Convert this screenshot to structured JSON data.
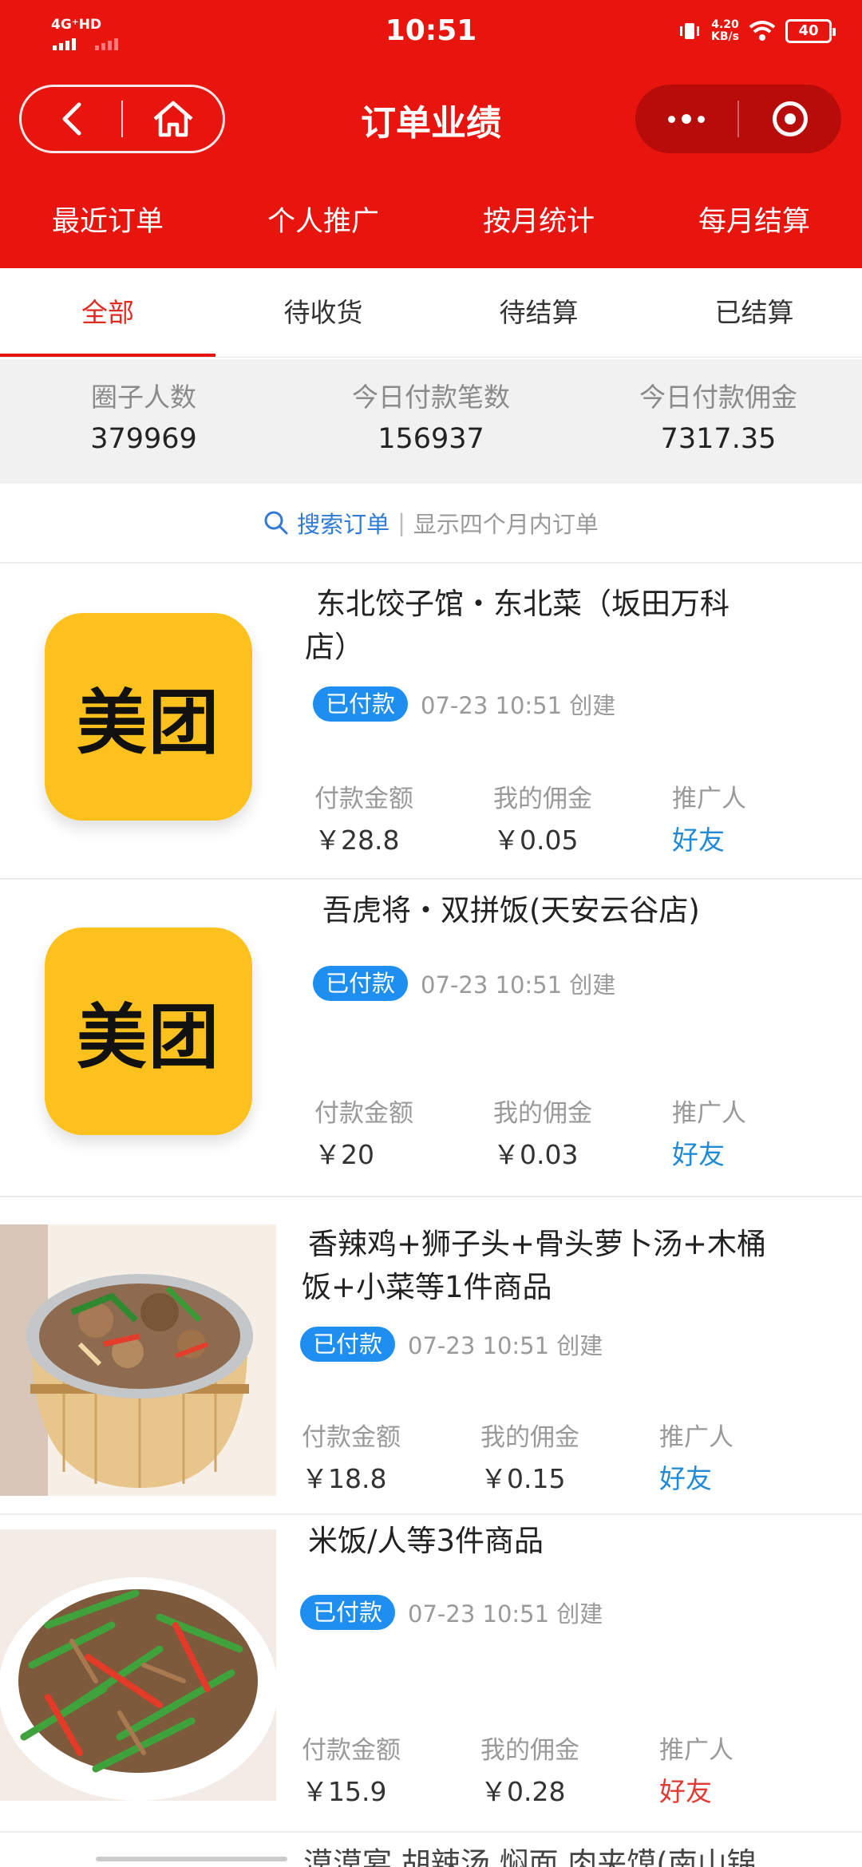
{
  "status_bar": {
    "network": "4G⁺HD",
    "time": "10:51",
    "speed_value": "4.20",
    "speed_unit": "KB/s",
    "battery": "40"
  },
  "header": {
    "title": "订单业绩",
    "back_icon": "back-arrow-icon",
    "home_icon": "home-icon",
    "more_icon": "more-dots-icon",
    "close_icon": "target-close-icon"
  },
  "top_tabs": [
    "最近订单",
    "个人推广",
    "按月统计",
    "每月结算"
  ],
  "sub_tabs": [
    "全部",
    "待收货",
    "待结算",
    "已结算"
  ],
  "active_sub_tab": 0,
  "stats": [
    {
      "label": "圈子人数",
      "value": "379969"
    },
    {
      "label": "今日付款笔数",
      "value": "156937"
    },
    {
      "label": "今日付款佣金",
      "value": "7317.35"
    }
  ],
  "search": {
    "link": "搜索订单",
    "separator": "|",
    "hint": "显示四个月内订单"
  },
  "order_labels": {
    "amount": "付款金额",
    "commission": "我的佣金",
    "promoter": "推广人"
  },
  "orders": [
    {
      "logo_text": "美团",
      "title_line1": "东北饺子馆・东北菜（坂田万科",
      "title_line2": "店）",
      "status": "已付款",
      "time": "07-23 10:51 创建",
      "amount": "￥28.8",
      "commission": "￥0.05",
      "promoter": "好友"
    },
    {
      "logo_text": "美团",
      "title_line1": "吾虎将・双拼饭(天安云谷店)",
      "title_line2": "",
      "status": "已付款",
      "time": "07-23 10:51 创建",
      "amount": "￥20",
      "commission": "￥0.03",
      "promoter": "好友"
    },
    {
      "image": "wooden-bucket-rice-photo",
      "title_line1": "香辣鸡+狮子头+骨头萝卜汤+木桶",
      "title_line2": "饭+小菜等1件商品",
      "status": "已付款",
      "time": "07-23 10:51 创建",
      "amount": "￥18.8",
      "commission": "￥0.15",
      "promoter": "好友"
    },
    {
      "image": "pepper-pork-stirfry-photo",
      "title_line1": "米饭/人等3件商品",
      "title_line2": "",
      "status": "已付款",
      "time": "07-23 10:51 创建",
      "amount": "￥15.9",
      "commission": "￥0.28",
      "promoter": "好友"
    }
  ],
  "peek_text": "漠漠宴  胡辣汤  焖面  肉夹馍(南山锦",
  "colors": {
    "header_red": "#e8150f",
    "badge_blue": "#1f8ef1",
    "meituan_yellow": "#fcc11c",
    "link_blue": "#2f7bd6",
    "promoter_red": "#e03a32"
  }
}
